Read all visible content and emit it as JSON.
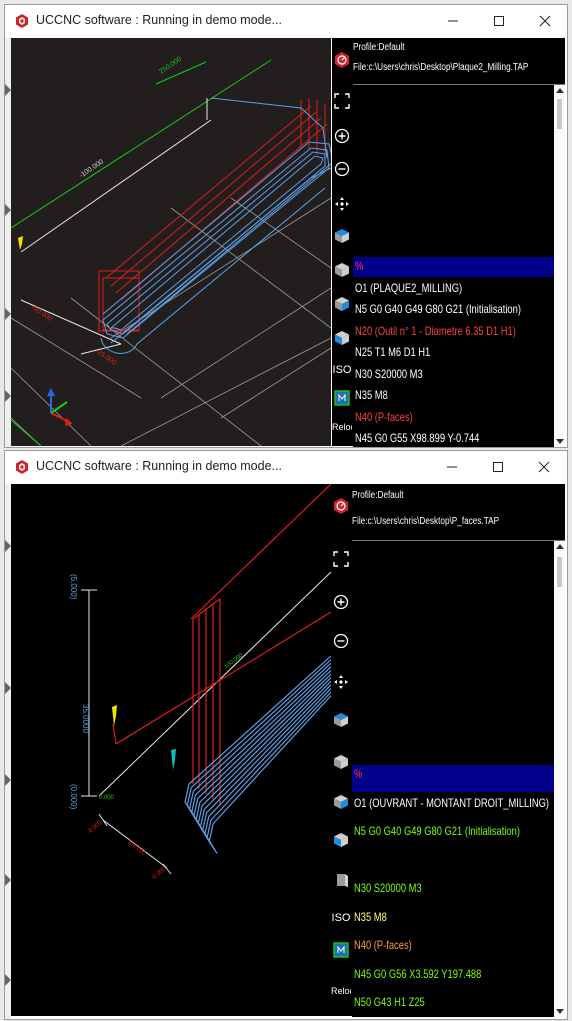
{
  "window1": {
    "title": "UCCNC software : Running in demo mode...",
    "profile": "Profile:Default",
    "file": "File:c:\\Users\\chris\\Desktop\\Plaque2_Milling.TAP",
    "iso_label": "ISO",
    "relocate_label": "Reloca",
    "code_lines": [
      {
        "text": "%",
        "color": "#ff3b3b",
        "highlight": true
      },
      {
        "text": "O1 (PLAQUE2_MILLING)",
        "color": "#ffffff",
        "accent": "(PLAQUE2_MILLING)",
        "accent_color": "#ff4040"
      },
      {
        "text": "N5 G0 G40 G49 G80 G21 (Initialisation)",
        "color": "#ffffff"
      },
      {
        "text": "N20 (Outil n° 1 - Diametre 6.35 D1 H1)",
        "color": "#ff4040"
      },
      {
        "text": "N25 T1 M6 D1 H1",
        "color": "#ffffff"
      },
      {
        "text": "N30 S20000 M3",
        "color": "#ffffff"
      },
      {
        "text": "N35 M8",
        "color": "#ffffff"
      },
      {
        "text": "N40 (P-faces)",
        "color": "#ff4040"
      },
      {
        "text": "N45 G0 G55 X98.899 Y-0.744",
        "color": "#ffffff"
      }
    ]
  },
  "window2": {
    "title": "UCCNC software : Running in demo mode...",
    "profile": "Profile:Default",
    "file": "File:c:\\Users\\chris\\Desktop\\P_faces.TAP",
    "iso_label": "ISO",
    "relocate_label": "Relocat",
    "code_lines": [
      {
        "text": "%",
        "color": "#ff3b3b",
        "highlight": true
      },
      {
        "text": "O1 (OUVRANT - MONTANT DROIT_MILLING)",
        "color": "#ffffff"
      },
      {
        "text": "N5 G0 G40 G49 G80 G21 (Initialisation)",
        "color": "#7cfc00"
      },
      {
        "text": "",
        "color": "#ffffff"
      },
      {
        "text": "N30 S20000 M3",
        "color": "#7cfc00"
      },
      {
        "text": "N35 M8",
        "color": "#ffff66"
      },
      {
        "text": "N40 (P-faces)",
        "color": "#ff9a40"
      },
      {
        "text": "N45 G0 G56 X3.592 Y197.488",
        "color": "#7cfc00"
      },
      {
        "text": "N50 G43 H1 Z25",
        "color": "#7cfc00"
      }
    ]
  },
  "colors": {
    "code_bg": "#000000",
    "highlight": "#00008b",
    "toolpath_blue": "#5aa0e6",
    "rapid_red": "#e01b1b",
    "grid_white": "#cfcfcf",
    "axis_green": "#17c917",
    "brand_red": "#d4252c"
  },
  "icons": [
    "cnc-logo-icon",
    "fit-view-icon",
    "zoom-in-icon",
    "zoom-out-icon",
    "pan-icon",
    "view-cube-icon",
    "minimize-icon",
    "maximize-icon",
    "close-icon"
  ]
}
